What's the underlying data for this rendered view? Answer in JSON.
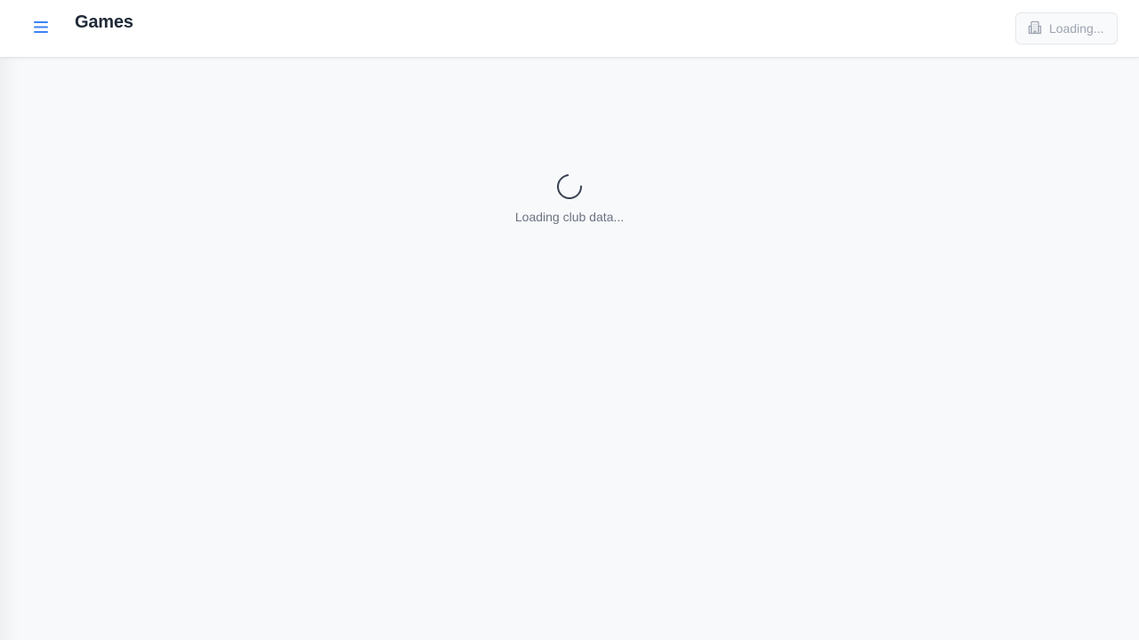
{
  "header": {
    "title": "Games",
    "menu_icon": "hamburger-menu-icon",
    "club_selector": {
      "label": "Loading...",
      "icon": "building-icon",
      "disabled": true
    }
  },
  "main": {
    "loading_message": "Loading club data...",
    "spinner_icon": "loading-spinner-icon"
  },
  "colors": {
    "accent": "#3b82f6",
    "background": "#f8f9fb",
    "header_bg": "#ffffff",
    "text_primary": "#1f2937",
    "text_muted": "#6b7280"
  }
}
